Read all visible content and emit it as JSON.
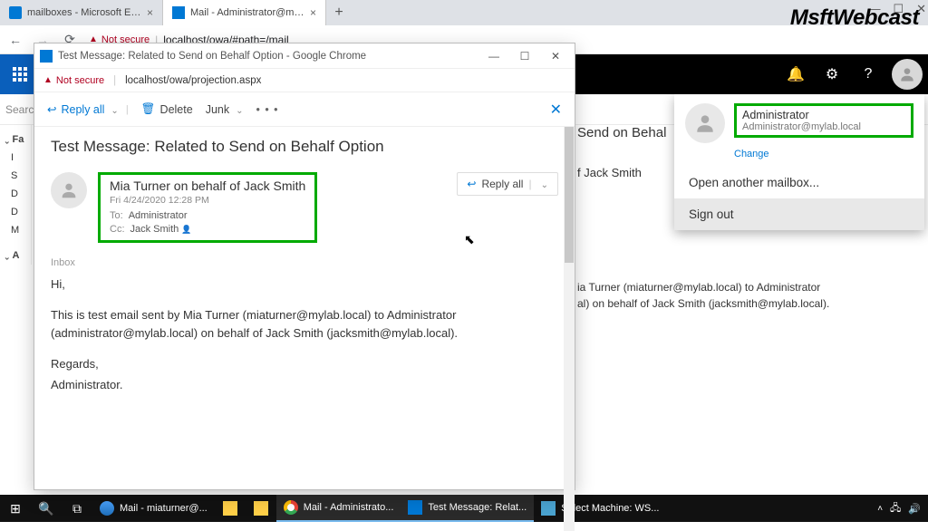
{
  "browser": {
    "tabs": [
      {
        "title": "mailboxes - Microsoft Exchange",
        "icon": "exchange"
      },
      {
        "title": "Mail - Administrator@mylab.loc",
        "icon": "owa"
      }
    ],
    "sys": {
      "min": "—",
      "max": "☐",
      "close": "✕"
    },
    "nav": {
      "back": "←",
      "fwd": "→",
      "reload": "⟳"
    },
    "security_label": "Not secure",
    "url": "localhost/owa/#path=/mail"
  },
  "watermark": "MsftWebcast",
  "owa_header": {
    "icons": {
      "bell": "🔔",
      "gear": "⚙",
      "help": "?"
    }
  },
  "search_placeholder": "Searc",
  "left_nav": {
    "fav_header": "Fa",
    "items": [
      "I",
      "S",
      "D",
      "D",
      "M"
    ],
    "admin_header": "A"
  },
  "profile_menu": {
    "name": "Administrator",
    "email": "Administrator@mylab.local",
    "change": "Change",
    "open_another": "Open another mailbox...",
    "sign_out": "Sign out"
  },
  "background_reading": {
    "subject_partial": "Send on Behal",
    "sender_partial": "f Jack Smith",
    "body_line1": "ia Turner (miaturner@mylab.local) to Administrator",
    "body_line2": "al) on behalf of Jack Smith (jacksmith@mylab.local)."
  },
  "popup": {
    "window_title": "Test Message: Related to Send on Behalf Option - Google Chrome",
    "sys": {
      "min": "—",
      "max": "☐",
      "close": "✕"
    },
    "security_label": "Not secure",
    "url": "localhost/owa/projection.aspx",
    "toolbar": {
      "reply_all": "Reply all",
      "delete": "Delete",
      "junk": "Junk",
      "more": "• • •"
    },
    "subject": "Test Message: Related to Send on Behalf Option",
    "sender": "Mia Turner on behalf of Jack Smith",
    "date": "Fri 4/24/2020 12:28 PM",
    "to_label": "To:",
    "to_value": "Administrator",
    "cc_label": "Cc:",
    "cc_value": "Jack Smith",
    "reply_btn": "Reply all",
    "inbox_label": "Inbox",
    "body": {
      "greeting": "Hi,",
      "para1": "This is test email sent by Mia Turner (miaturner@mylab.local) to Administrator (administrator@mylab.local) on behalf of Jack Smith (jacksmith@mylab.local).",
      "signoff1": "Regards,",
      "signoff2": "Administrator."
    }
  },
  "taskbar": {
    "items": [
      {
        "icon": "ie",
        "label": "Mail - miaturner@..."
      },
      {
        "icon": "folder",
        "label": ""
      },
      {
        "icon": "folder",
        "label": ""
      },
      {
        "icon": "chrome",
        "label": "Mail - Administrato..."
      },
      {
        "icon": "outlook",
        "label": "Test Message: Relat..."
      },
      {
        "icon": "hyper",
        "label": "Select Machine: WS..."
      }
    ]
  }
}
